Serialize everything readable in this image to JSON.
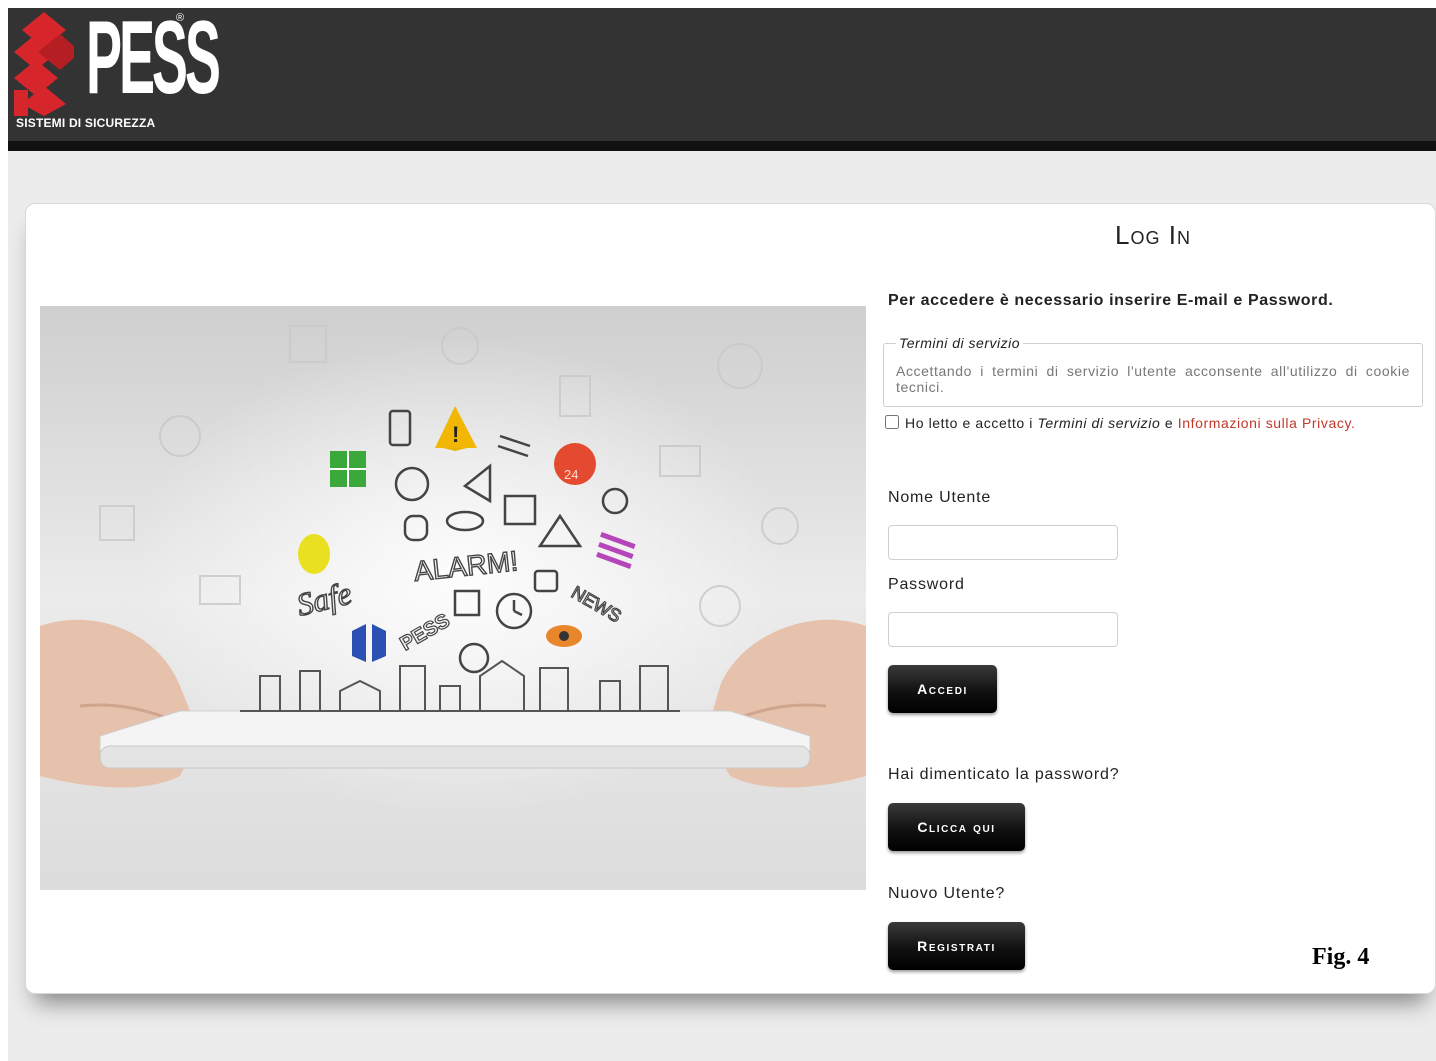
{
  "brand": {
    "logo_word": "PESS",
    "logo_reg": "®",
    "logo_subtitle": "SISTEMI DI SICUREZZA",
    "logo_colors": {
      "red": "#d7262b",
      "white": "#ffffff"
    },
    "header_color": "#333333"
  },
  "login": {
    "title": "Log In",
    "intro": "Per accedere è necessario inserire E-mail e Password.",
    "terms": {
      "legend": "Termini di servizio",
      "text": "Accettando i termini di servizio l'utente acconsente all'utilizzo di cookie tecnici."
    },
    "accept": {
      "checked": false,
      "part1": "Ho letto e accetto i ",
      "terms_link": "Termini di servizio",
      "part2": " e ",
      "privacy_link": "Informazioni sulla Privacy",
      "end": "."
    },
    "username_label": "Nome Utente",
    "username_value": "",
    "password_label": "Password",
    "password_value": "",
    "submit_label": "Accedi",
    "forgot_text": "Hai dimenticato la password?",
    "forgot_button": "Clicca qui",
    "new_user_text": "Nuovo Utente?",
    "register_button": "Registrati"
  },
  "hero": {
    "labels": [
      "ALARM!",
      "Safe",
      "NEWS",
      "PESS",
      "24"
    ],
    "icon_names": [
      "warning-icon",
      "phone-icon",
      "alarm-clock-icon",
      "lock-icon",
      "eye-icon",
      "light-bulb-icon",
      "megaphone-icon",
      "camera-icon",
      "building-icon"
    ]
  },
  "caption": "Fig. 4"
}
